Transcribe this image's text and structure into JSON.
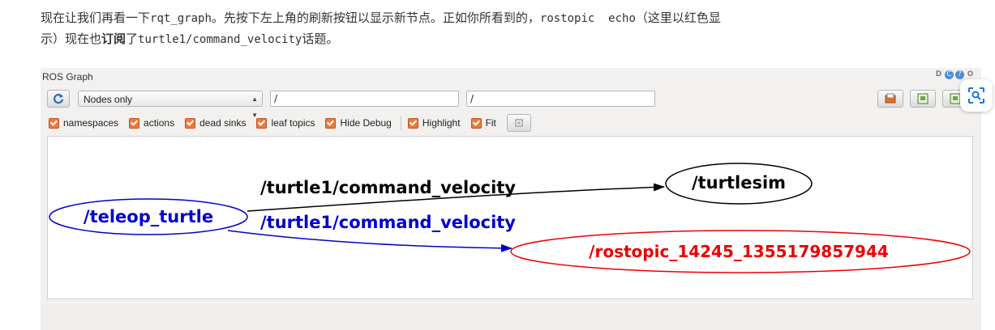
{
  "article": {
    "line1_a": "现在让我们再看一下",
    "code1": "rqt_graph",
    "line1_b": "。先按下左上角的刷新按钮以显示新节点。正如你所看到的，",
    "code2": "rostopic  echo",
    "line1_c": "（这里以红色显",
    "line2_a": "示）现在也",
    "bold": "订阅",
    "line2_b": "了",
    "code3": "turtle1/command_velocity",
    "line2_c": "话题。"
  },
  "window": {
    "title": "ROS Graph",
    "controls": [
      "D",
      "C",
      "?",
      "O"
    ]
  },
  "toolbar": {
    "mode_selected": "Nodes only",
    "filter1_value": "/",
    "filter2_value": "/"
  },
  "checkboxes": [
    {
      "label": "namespaces",
      "checked": true
    },
    {
      "label": "actions",
      "checked": true
    },
    {
      "label": "dead sinks",
      "checked": true
    },
    {
      "label": "leaf topics",
      "checked": true
    },
    {
      "label": "Hide Debug",
      "checked": true
    },
    {
      "label": "Highlight",
      "checked": true
    },
    {
      "label": "Fit",
      "checked": true
    }
  ],
  "graph": {
    "nodes": {
      "teleop": "/teleop_turtle",
      "turtlesim": "/turtlesim",
      "rostopic": "/rostopic_14245_1355179857944"
    },
    "edges": {
      "edge1_label": "/turtle1/command_velocity",
      "edge2_label": "/turtle1/command_velocity"
    },
    "colors": {
      "default": "#000000",
      "highlight_blue": "#0000cc",
      "highlight_red": "#ee0000"
    }
  },
  "icons": {
    "refresh": "refresh-icon",
    "load": "folder-open-icon",
    "save_dot": "save-dot-icon",
    "save_image": "save-image-icon",
    "scan": "scan-icon",
    "fit_view": "fit-view-icon"
  }
}
